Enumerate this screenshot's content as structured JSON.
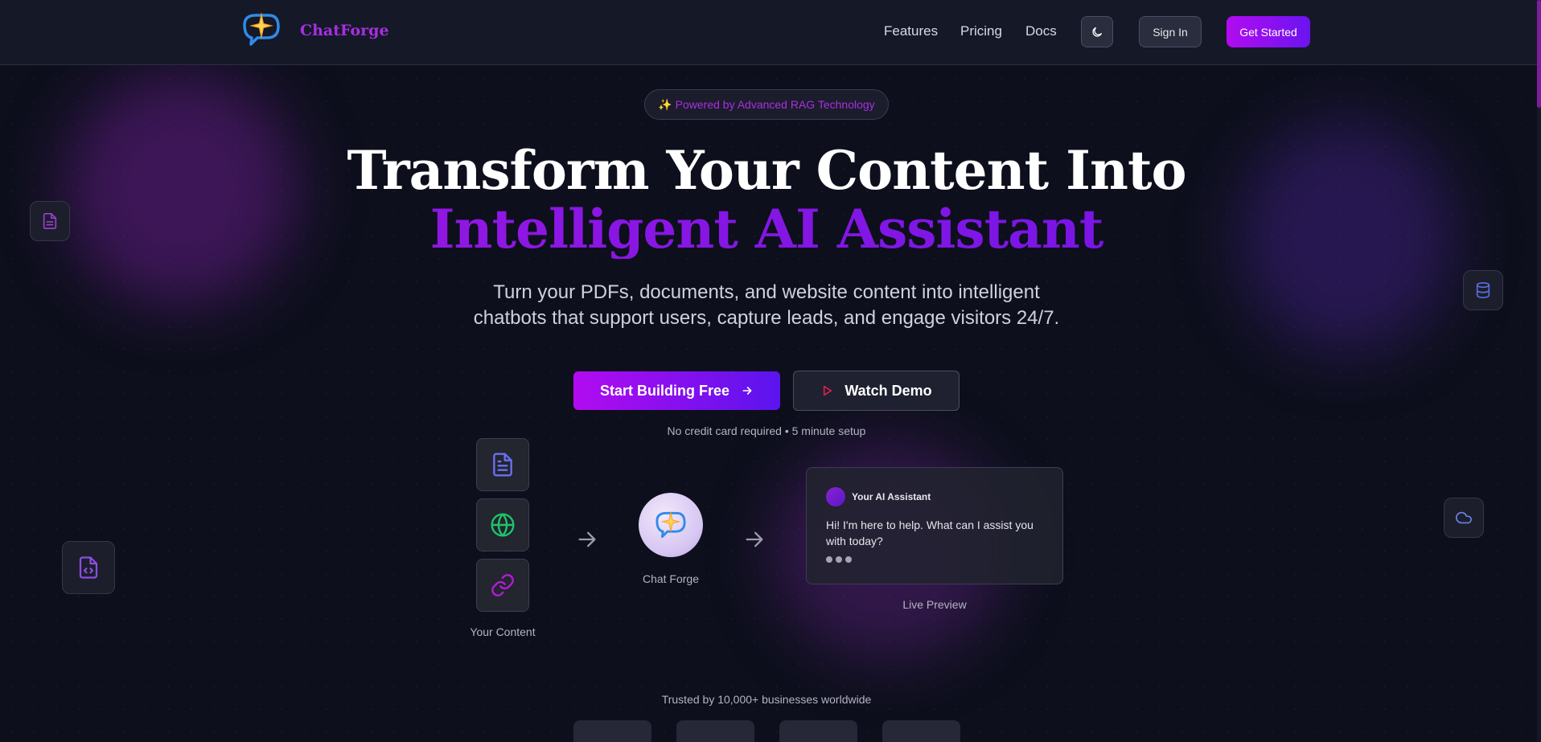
{
  "header": {
    "brand": "ChatForge",
    "nav": [
      "Features",
      "Pricing",
      "Docs"
    ],
    "theme_toggle_icon": "moon-icon",
    "sign_in": "Sign In",
    "get_started": "Get Started"
  },
  "hero": {
    "badge": "✨ Powered by Advanced RAG Technology",
    "title_line1": "Transform Your Content Into",
    "title_line2": "Intelligent AI Assistant",
    "subtitle_line1": "Turn your PDFs, documents, and website content into intelligent",
    "subtitle_line2": "chatbots that support users, capture leads, and engage visitors 24/7.",
    "primary_cta": "Start Building Free",
    "secondary_cta": "Watch Demo",
    "note": "No credit card required • 5 minute setup"
  },
  "flow": {
    "sources": [
      "document-icon",
      "globe-icon",
      "link-icon"
    ],
    "sources_caption": "Your Content",
    "hub_caption": "Chat Forge",
    "preview": {
      "name": "Your AI Assistant",
      "message": "Hi! I'm here to help. What can I assist you with today?",
      "caption": "Live Preview"
    }
  },
  "trusted": {
    "text": "Trusted by 10,000+ businesses worldwide"
  },
  "colors": {
    "accent": "#a62fe0",
    "accent_end": "#6a14f0",
    "background": "#0d0f1c"
  }
}
